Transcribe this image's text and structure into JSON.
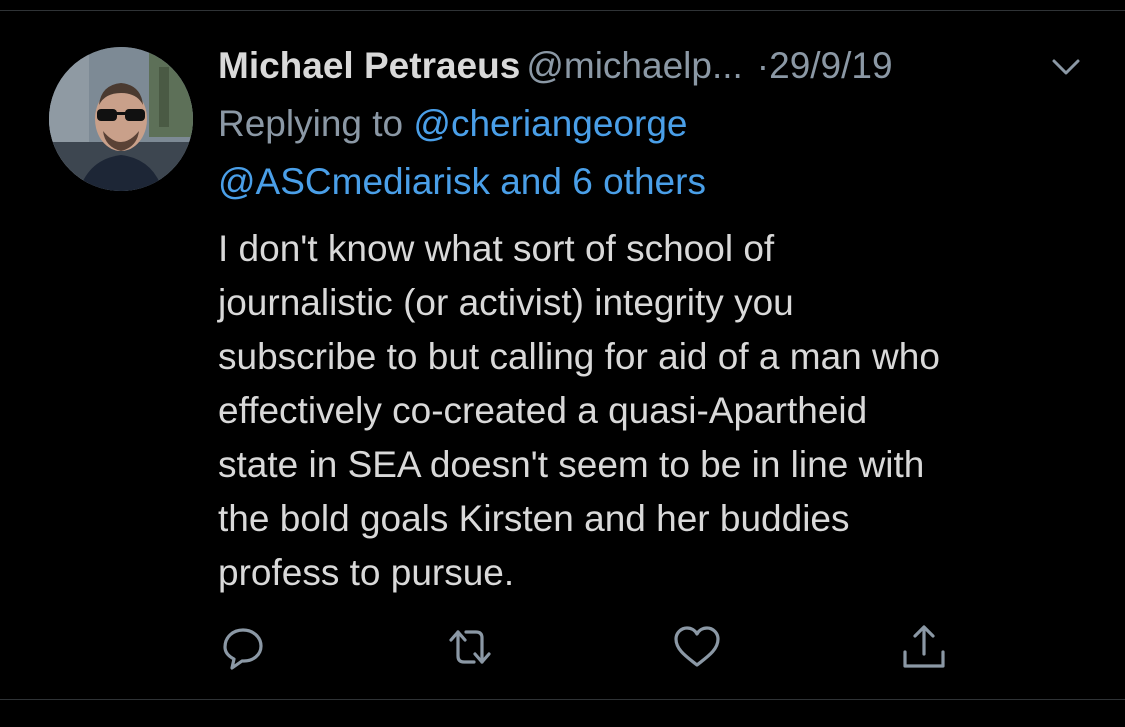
{
  "tweet": {
    "author": {
      "display_name": "Michael Petraeus",
      "handle": "@michaelp...",
      "avatar_icon": "profile-photo"
    },
    "separator": "·",
    "date": "29/9/19",
    "menu_icon": "chevron-down-icon",
    "replying_to": {
      "prefix": "Replying to",
      "mention_1": "@cheriangeorge",
      "mention_2": "@ASCmediarisk and 6 others"
    },
    "text_lines": [
      "I don't know what sort of school of",
      "journalistic (or activist) integrity you",
      "subscribe to but calling for aid of a man who",
      "effectively co-created a quasi-Apartheid",
      "state in SEA doesn't seem to be in line with",
      "the bold goals Kirsten and her buddies",
      "profess to pursue."
    ],
    "actions": [
      {
        "name": "reply",
        "icon": "reply-icon"
      },
      {
        "name": "retweet",
        "icon": "retweet-icon"
      },
      {
        "name": "like",
        "icon": "heart-icon"
      },
      {
        "name": "share",
        "icon": "share-icon"
      }
    ]
  },
  "colors": {
    "background": "#000000",
    "text": "#d9d9d9",
    "secondary": "#8b98a5",
    "link": "#4a9fe8",
    "icon": "#8b98a5"
  }
}
